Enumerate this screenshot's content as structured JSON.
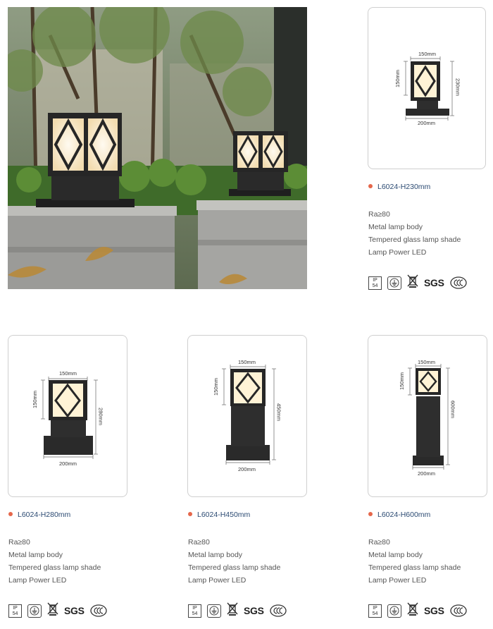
{
  "products": [
    {
      "model": "L6024-H230mm",
      "dims": {
        "top": "150mm",
        "side": "150mm",
        "height": "230mm",
        "base": "200mm"
      },
      "specs": [
        "Ra≥80",
        "Metal lamp body",
        "Tempered glass lamp shade",
        "Lamp Power LED"
      ]
    },
    {
      "model": "L6024-H280mm",
      "dims": {
        "top": "150mm",
        "side": "150mm",
        "height": "280mm",
        "base": "200mm"
      },
      "specs": [
        "Ra≥80",
        "Metal lamp body",
        "Tempered glass lamp shade",
        "Lamp Power LED"
      ]
    },
    {
      "model": "L6024-H450mm",
      "dims": {
        "top": "150mm",
        "side": "150mm",
        "height": "450mm",
        "base": "200mm"
      },
      "specs": [
        "Ra≥80",
        "Metal lamp body",
        "Tempered glass lamp shade",
        "Lamp Power LED"
      ]
    },
    {
      "model": "L6024-H600mm",
      "dims": {
        "top": "150mm",
        "side": "150mm",
        "height": "600mm",
        "base": "200mm"
      },
      "specs": [
        "Ra≥80",
        "Metal lamp body",
        "Tempered glass lamp shade",
        "Lamp Power LED"
      ]
    }
  ],
  "certs": {
    "ip_top": "IP",
    "ip_bottom": "54",
    "sgs": "SGS"
  },
  "colors": {
    "bullet": "#e5674b",
    "model_text": "#2b4a72",
    "card_border": "#cfcfcf",
    "lamp_body": "#2a2a2a",
    "lamp_glow": "#fff3d6"
  }
}
